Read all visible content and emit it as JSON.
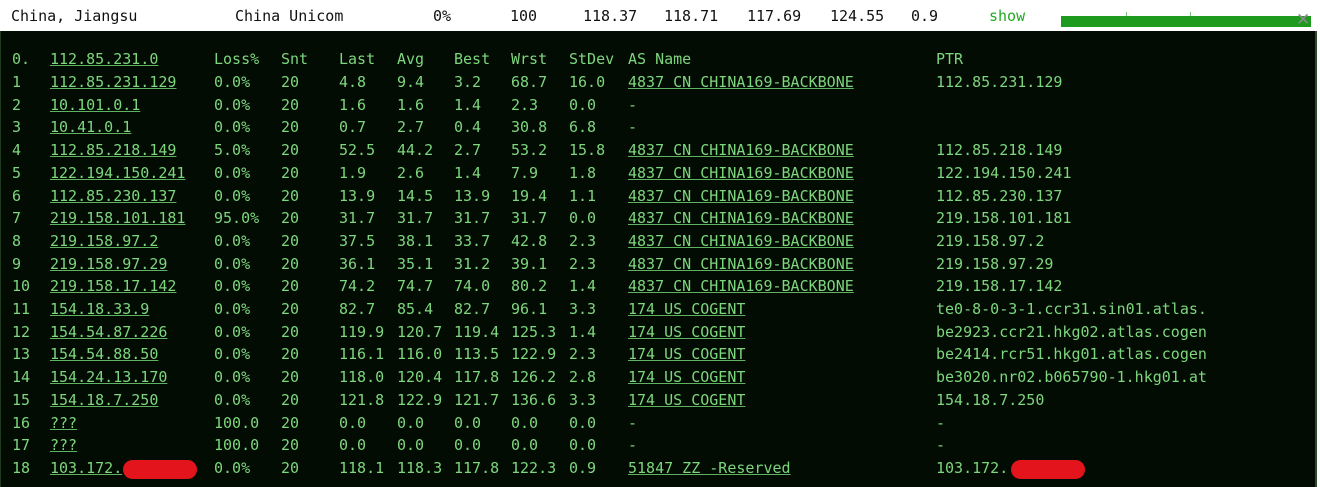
{
  "summary": {
    "location": "China, Jiangsu",
    "isp": "China Unicom",
    "loss": "0%",
    "sent": "100",
    "last": "118.37",
    "avg": "118.71",
    "best": "117.69",
    "worst": "124.55",
    "stdev": "0.9",
    "show_label": "show",
    "close_glyph": "✕",
    "accent": "#1e9a1e"
  },
  "header": {
    "hop": "0.",
    "host": "112.85.231.0",
    "loss": "Loss%",
    "snt": "Snt",
    "last": "Last",
    "avg": "Avg",
    "best": "Best",
    "wrst": "Wrst",
    "stdev": "StDev",
    "as": "AS Name",
    "ptr": "PTR"
  },
  "rows": [
    {
      "hop": "1",
      "host": "112.85.231.129",
      "loss": "0.0%",
      "snt": "20",
      "last": "4.8",
      "avg": "9.4",
      "best": "3.2",
      "wrst": "68.7",
      "stdev": "16.0",
      "as": "4837  CN CHINA169-BACKBONE",
      "ptr": "112.85.231.129"
    },
    {
      "hop": "2",
      "host": "10.101.0.1",
      "loss": "0.0%",
      "snt": "20",
      "last": "1.6",
      "avg": "1.6",
      "best": "1.4",
      "wrst": "2.3",
      "stdev": "0.0",
      "as": "-",
      "ptr": ""
    },
    {
      "hop": "3",
      "host": "10.41.0.1",
      "loss": "0.0%",
      "snt": "20",
      "last": "0.7",
      "avg": "2.7",
      "best": "0.4",
      "wrst": "30.8",
      "stdev": "6.8",
      "as": "-",
      "ptr": ""
    },
    {
      "hop": "4",
      "host": "112.85.218.149",
      "loss": "5.0%",
      "snt": "20",
      "last": "52.5",
      "avg": "44.2",
      "best": "2.7",
      "wrst": "53.2",
      "stdev": "15.8",
      "as": "4837  CN CHINA169-BACKBONE",
      "ptr": "112.85.218.149"
    },
    {
      "hop": "5",
      "host": "122.194.150.241",
      "loss": "0.0%",
      "snt": "20",
      "last": "1.9",
      "avg": "2.6",
      "best": "1.4",
      "wrst": "7.9",
      "stdev": "1.8",
      "as": "4837  CN CHINA169-BACKBONE",
      "ptr": "122.194.150.241"
    },
    {
      "hop": "6",
      "host": "112.85.230.137",
      "loss": "0.0%",
      "snt": "20",
      "last": "13.9",
      "avg": "14.5",
      "best": "13.9",
      "wrst": "19.4",
      "stdev": "1.1",
      "as": "4837  CN CHINA169-BACKBONE",
      "ptr": "112.85.230.137"
    },
    {
      "hop": "7",
      "host": "219.158.101.181",
      "loss": "95.0%",
      "snt": "20",
      "last": "31.7",
      "avg": "31.7",
      "best": "31.7",
      "wrst": "31.7",
      "stdev": "0.0",
      "as": "4837  CN CHINA169-BACKBONE",
      "ptr": "219.158.101.181"
    },
    {
      "hop": "8",
      "host": "219.158.97.2",
      "loss": "0.0%",
      "snt": "20",
      "last": "37.5",
      "avg": "38.1",
      "best": "33.7",
      "wrst": "42.8",
      "stdev": "2.3",
      "as": "4837  CN CHINA169-BACKBONE",
      "ptr": "219.158.97.2"
    },
    {
      "hop": "9",
      "host": "219.158.97.29",
      "loss": "0.0%",
      "snt": "20",
      "last": "36.1",
      "avg": "35.1",
      "best": "31.2",
      "wrst": "39.1",
      "stdev": "2.3",
      "as": "4837  CN CHINA169-BACKBONE",
      "ptr": "219.158.97.29"
    },
    {
      "hop": "10",
      "host": "219.158.17.142",
      "loss": "0.0%",
      "snt": "20",
      "last": "74.2",
      "avg": "74.7",
      "best": "74.0",
      "wrst": "80.2",
      "stdev": "1.4",
      "as": "4837  CN CHINA169-BACKBONE",
      "ptr": "219.158.17.142"
    },
    {
      "hop": "11",
      "host": "154.18.33.9",
      "loss": "0.0%",
      "snt": "20",
      "last": "82.7",
      "avg": "85.4",
      "best": "82.7",
      "wrst": "96.1",
      "stdev": "3.3",
      "as": "174   US COGENT",
      "ptr": "te0-8-0-3-1.ccr31.sin01.atlas."
    },
    {
      "hop": "12",
      "host": "154.54.87.226",
      "loss": "0.0%",
      "snt": "20",
      "last": "119.9",
      "avg": "120.7",
      "best": "119.4",
      "wrst": "125.3",
      "stdev": "1.4",
      "as": "174   US COGENT",
      "ptr": "be2923.ccr21.hkg02.atlas.cogen"
    },
    {
      "hop": "13",
      "host": "154.54.88.50",
      "loss": "0.0%",
      "snt": "20",
      "last": "116.1",
      "avg": "116.0",
      "best": "113.5",
      "wrst": "122.9",
      "stdev": "2.3",
      "as": "174   US COGENT",
      "ptr": "be2414.rcr51.hkg01.atlas.cogen"
    },
    {
      "hop": "14",
      "host": "154.24.13.170",
      "loss": "0.0%",
      "snt": "20",
      "last": "118.0",
      "avg": "120.4",
      "best": "117.8",
      "wrst": "126.2",
      "stdev": "2.8",
      "as": "174   US COGENT",
      "ptr": "be3020.nr02.b065790-1.hkg01.at"
    },
    {
      "hop": "15",
      "host": "154.18.7.250",
      "loss": "0.0%",
      "snt": "20",
      "last": "121.8",
      "avg": "122.9",
      "best": "121.7",
      "wrst": "136.6",
      "stdev": "3.3",
      "as": "174   US COGENT",
      "ptr": "154.18.7.250"
    },
    {
      "hop": "16",
      "host": "???",
      "loss": "100.0",
      "snt": "20",
      "last": "0.0",
      "avg": "0.0",
      "best": "0.0",
      "wrst": "0.0",
      "stdev": "0.0",
      "as": "-",
      "ptr": "-"
    },
    {
      "hop": "17",
      "host": "???",
      "loss": "100.0",
      "snt": "20",
      "last": "0.0",
      "avg": "0.0",
      "best": "0.0",
      "wrst": "0.0",
      "stdev": "0.0",
      "as": "-",
      "ptr": "-"
    },
    {
      "hop": "18",
      "host": "103.172.",
      "loss": "0.0%",
      "snt": "20",
      "last": "118.1",
      "avg": "118.3",
      "best": "117.8",
      "wrst": "122.3",
      "stdev": "0.9",
      "as": "51847 ZZ -Reserved",
      "ptr": "103.172."
    }
  ],
  "colors": {
    "terminal_bg": "#020c02",
    "terminal_text": "#7ed67e",
    "redaction": "#e3141b"
  }
}
